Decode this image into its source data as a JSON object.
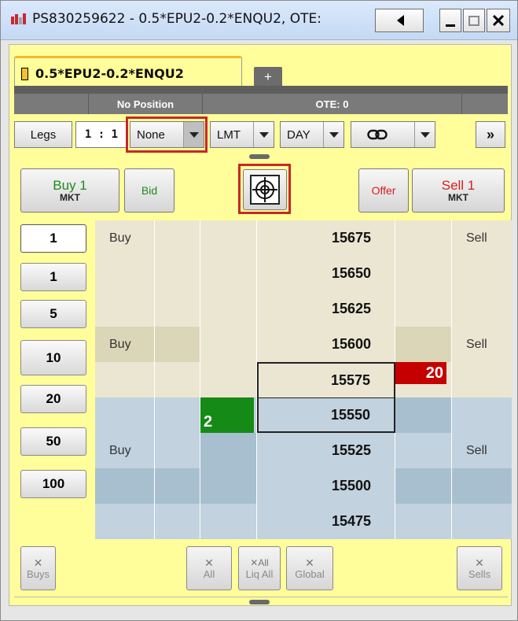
{
  "window": {
    "title": "PS830259622 - 0.5*EPU2-0.2*ENQU2, OTE:",
    "buttons": [
      "speaker-back",
      "minimize",
      "maximize",
      "close"
    ]
  },
  "tab": {
    "label": "0.5*EPU2-0.2*ENQU2",
    "add_label": "+"
  },
  "status": {
    "position": "No Position",
    "ote": "OTE: 0"
  },
  "toolbar": {
    "legs": "Legs",
    "ratio": "1 : 1",
    "strategy": "None",
    "order_type": "LMT",
    "tif": "DAY",
    "link_icon": "link-icon",
    "more": "»"
  },
  "actions": {
    "buy": {
      "label": "Buy 1",
      "sub": "MKT",
      "color": "#1e8a1e"
    },
    "bid": {
      "label": "Bid",
      "color": "#1e8a1e"
    },
    "offer": {
      "label": "Offer",
      "color": "#d42020"
    },
    "sell": {
      "label": "Sell 1",
      "sub": "MKT",
      "color": "#d42020"
    },
    "center_icon": "crosshair-icon"
  },
  "quantities": [
    "1",
    "1",
    "5",
    "10",
    "20",
    "50",
    "100"
  ],
  "ladder": [
    {
      "price": "15675",
      "buy": "Buy",
      "sell": "Sell",
      "bid_qty": "",
      "ask_qty": ""
    },
    {
      "price": "15650",
      "buy": "",
      "sell": "",
      "bid_qty": "",
      "ask_qty": ""
    },
    {
      "price": "15625",
      "buy": "",
      "sell": "",
      "bid_qty": "",
      "ask_qty": ""
    },
    {
      "price": "15600",
      "buy": "Buy",
      "sell": "Sell",
      "bid_qty": "",
      "ask_qty": ""
    },
    {
      "price": "15575",
      "buy": "",
      "sell": "",
      "bid_qty": "",
      "ask_qty": "20"
    },
    {
      "price": "15550",
      "buy": "",
      "sell": "",
      "bid_qty": "2",
      "ask_qty": ""
    },
    {
      "price": "15525",
      "buy": "Buy",
      "sell": "Sell",
      "bid_qty": "",
      "ask_qty": ""
    },
    {
      "price": "15500",
      "buy": "",
      "sell": "",
      "bid_qty": "",
      "ask_qty": ""
    },
    {
      "price": "15475",
      "buy": "",
      "sell": "",
      "bid_qty": "",
      "ask_qty": ""
    }
  ],
  "bottom": {
    "buys": "Buys",
    "all": "All",
    "all_top": "All",
    "liq_all": "Liq All",
    "global": "Global",
    "sells": "Sells"
  },
  "colors": {
    "panel": "#fffe9a",
    "ask_fill": "#c40000",
    "bid_fill": "#168a16",
    "highlight_box": "#c62828"
  }
}
